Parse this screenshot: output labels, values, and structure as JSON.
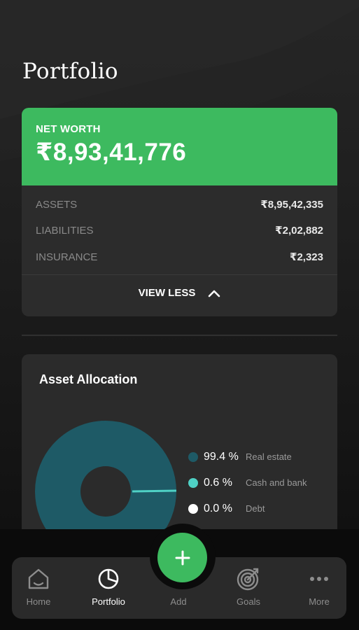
{
  "page": {
    "title": "Portfolio"
  },
  "net_worth": {
    "label": "NET WORTH",
    "value": "₹8,93,41,776",
    "rows": [
      {
        "label": "ASSETS",
        "value": "₹8,95,42,335"
      },
      {
        "label": "LIABILITIES",
        "value": "₹2,02,882"
      },
      {
        "label": "INSURANCE",
        "value": "₹2,323"
      }
    ],
    "toggle_label": "VIEW LESS"
  },
  "allocation": {
    "title": "Asset Allocation",
    "legend": [
      {
        "pct": "99.4 %",
        "name": "Real estate",
        "color": "#1e5a66"
      },
      {
        "pct": "0.6 %",
        "name": "Cash and bank",
        "color": "#4fd1c5"
      },
      {
        "pct": "0.0 %",
        "name": "Debt",
        "color": "#ffffff"
      }
    ]
  },
  "nav": {
    "home": "Home",
    "portfolio": "Portfolio",
    "add": "Add",
    "goals": "Goals",
    "more": "More"
  },
  "colors": {
    "accent": "#3dba5f",
    "card": "#2c2c2c"
  }
}
